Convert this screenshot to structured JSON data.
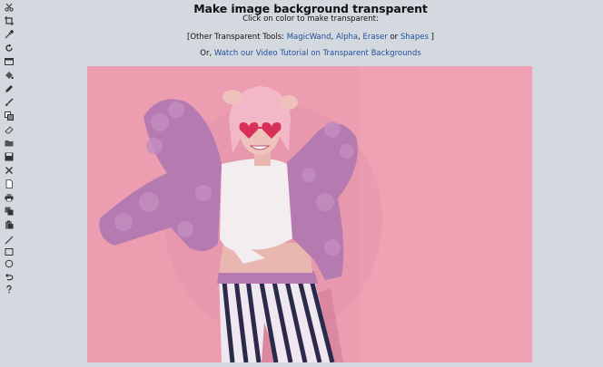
{
  "page": {
    "title": "Make image background transparent",
    "subtitle": "Click on color to make transparent:",
    "tools_prefix": "[Other Transparent Tools: ",
    "tools": [
      {
        "label": "MagicWand"
      },
      {
        "label": "Alpha"
      },
      {
        "label": "Eraser"
      },
      {
        "label": "Shapes"
      }
    ],
    "sep_comma1": ", ",
    "sep_comma2": ", ",
    "sep_or": " or ",
    "tools_suffix": " ]",
    "video_prefix": "Or, ",
    "video_link": "Watch our Video Tutorial on Transparent Backgrounds"
  },
  "toolbar": {
    "icons": [
      "scissors-icon",
      "crop-icon",
      "dropper-icon",
      "rotate-icon",
      "resize-icon",
      "paint-bucket-icon",
      "pen-icon",
      "brush-icon",
      "layers-icon",
      "eraser-icon",
      "open-folder-icon",
      "save-icon",
      "close-icon",
      "new-file-icon",
      "print-icon",
      "copy-icon",
      "paste-icon",
      "line-icon",
      "rectangle-icon",
      "circle-icon",
      "undo-icon",
      "help-icon"
    ]
  },
  "colors": {
    "background": "#d4d9e0",
    "link": "#1f4e9b",
    "photo_backdrop": "#ea9aae",
    "jacket": "#b57ab0",
    "shirt": "#f2eef0",
    "hair": "#f3b8c8",
    "pants_stripe": "#2b2a4a"
  }
}
